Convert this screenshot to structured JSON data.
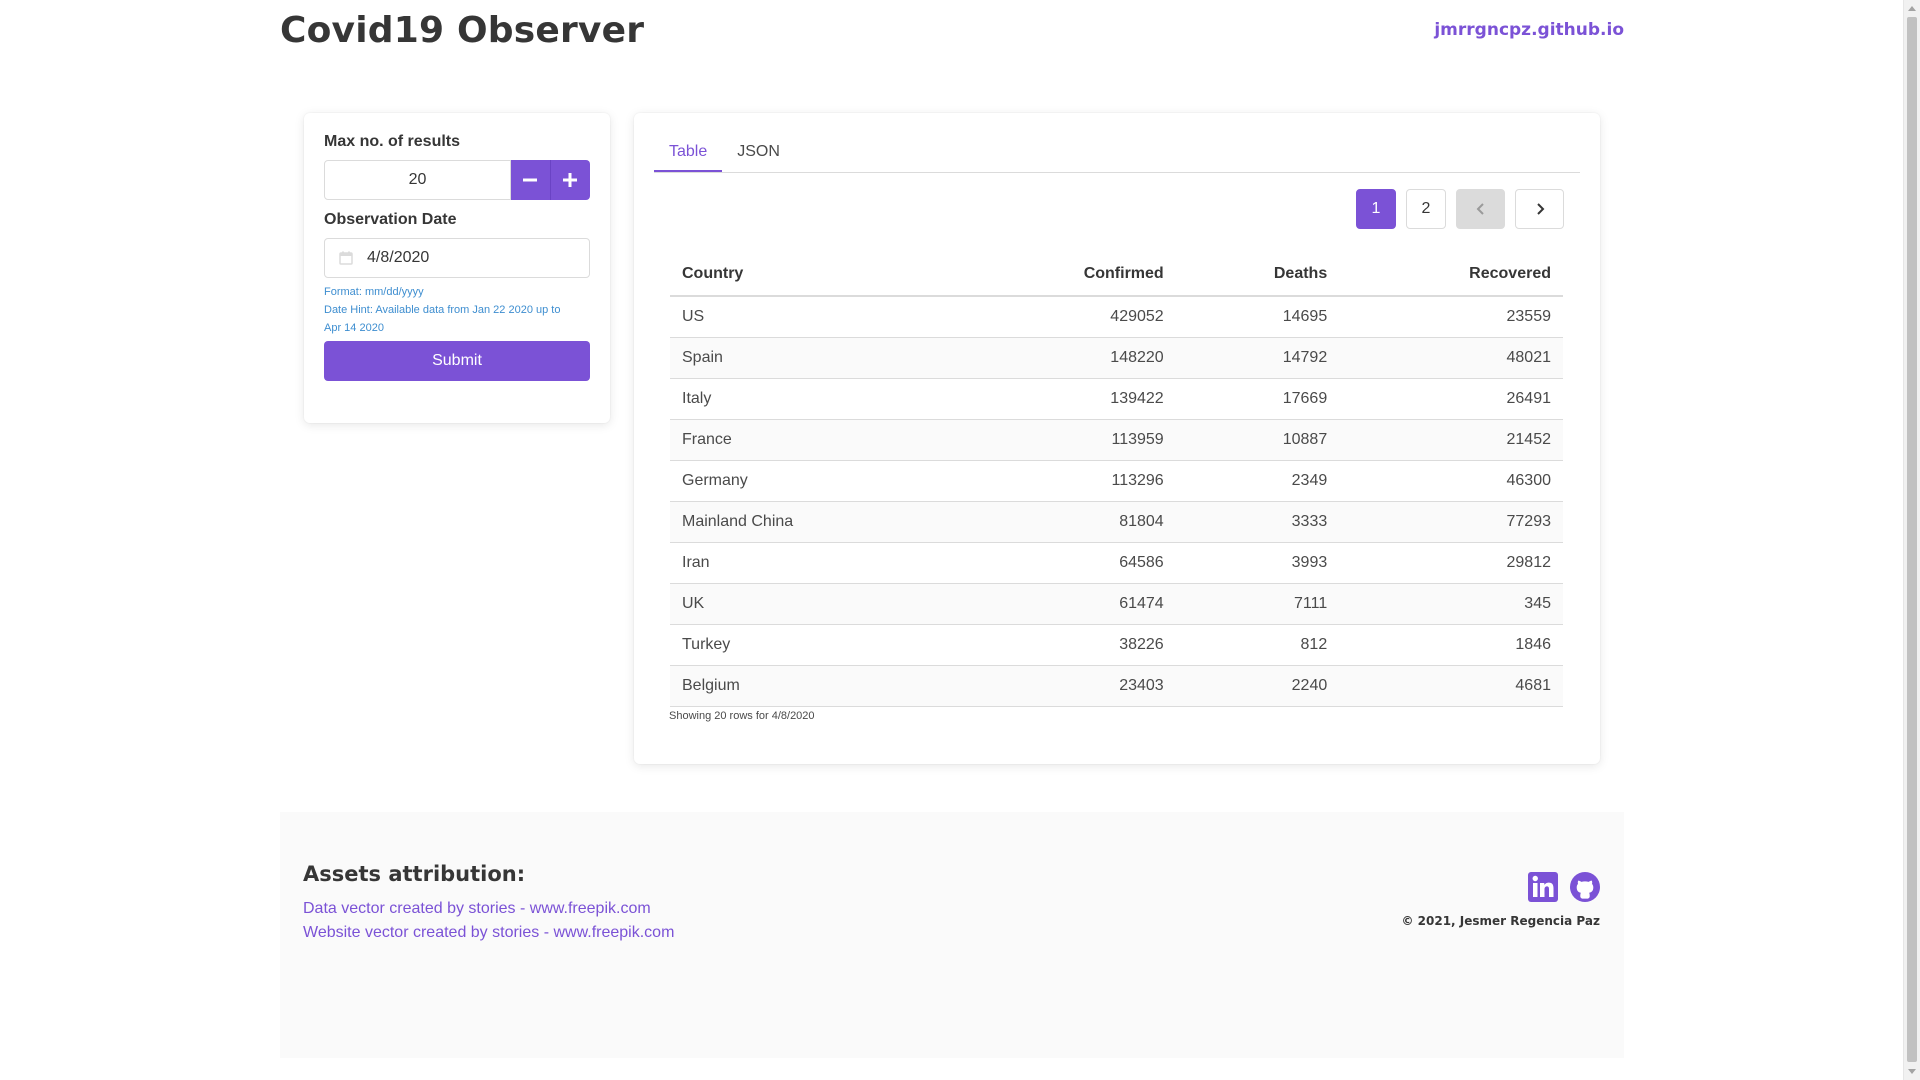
{
  "header": {
    "title": "Covid19 Observer",
    "link": "jmrrgncpz.github.io"
  },
  "form": {
    "max_label": "Max no. of results",
    "max_value": "20",
    "minus_icon": "minus-icon",
    "plus_icon": "plus-icon",
    "date_label": "Observation Date",
    "date_value": "4/8/2020",
    "calendar_icon": "calendar-icon",
    "format_hint": "Format: mm/dd/yyyy",
    "date_hint_1": "Date Hint: Available data from Jan 22 2020 up to",
    "date_hint_2": "Apr 14 2020",
    "submit_label": "Submit"
  },
  "tabs": [
    {
      "label": "Table",
      "active": true
    },
    {
      "label": "JSON",
      "active": false
    }
  ],
  "pagination": {
    "pages": [
      "1",
      "2"
    ],
    "current": "1",
    "prev_icon": "chevron-left-icon",
    "next_icon": "chevron-right-icon"
  },
  "table": {
    "columns": [
      "Country",
      "Confirmed",
      "Deaths",
      "Recovered"
    ],
    "rows": [
      [
        "US",
        "429052",
        "14695",
        "23559"
      ],
      [
        "Spain",
        "148220",
        "14792",
        "48021"
      ],
      [
        "Italy",
        "139422",
        "17669",
        "26491"
      ],
      [
        "France",
        "113959",
        "10887",
        "21452"
      ],
      [
        "Germany",
        "113296",
        "2349",
        "46300"
      ],
      [
        "Mainland China",
        "81804",
        "3333",
        "77293"
      ],
      [
        "Iran",
        "64586",
        "3993",
        "29812"
      ],
      [
        "UK",
        "61474",
        "7111",
        "345"
      ],
      [
        "Turkey",
        "38226",
        "812",
        "1846"
      ],
      [
        "Belgium",
        "23403",
        "2240",
        "4681"
      ]
    ],
    "caption": "Showing 20 rows for 4/8/2020"
  },
  "footer": {
    "attribution_title": "Assets attribution:",
    "link_1": "Data vector created by stories - www.freepik.com",
    "link_2": "Website vector created by stories - www.freepik.com",
    "copyright": "© 2021, Jesmer Regencia Paz",
    "icons": [
      "linkedin-icon",
      "github-icon"
    ]
  },
  "colors": {
    "accent": "#7b52d6",
    "hint": "#3e8ed0",
    "text": "#363636"
  }
}
